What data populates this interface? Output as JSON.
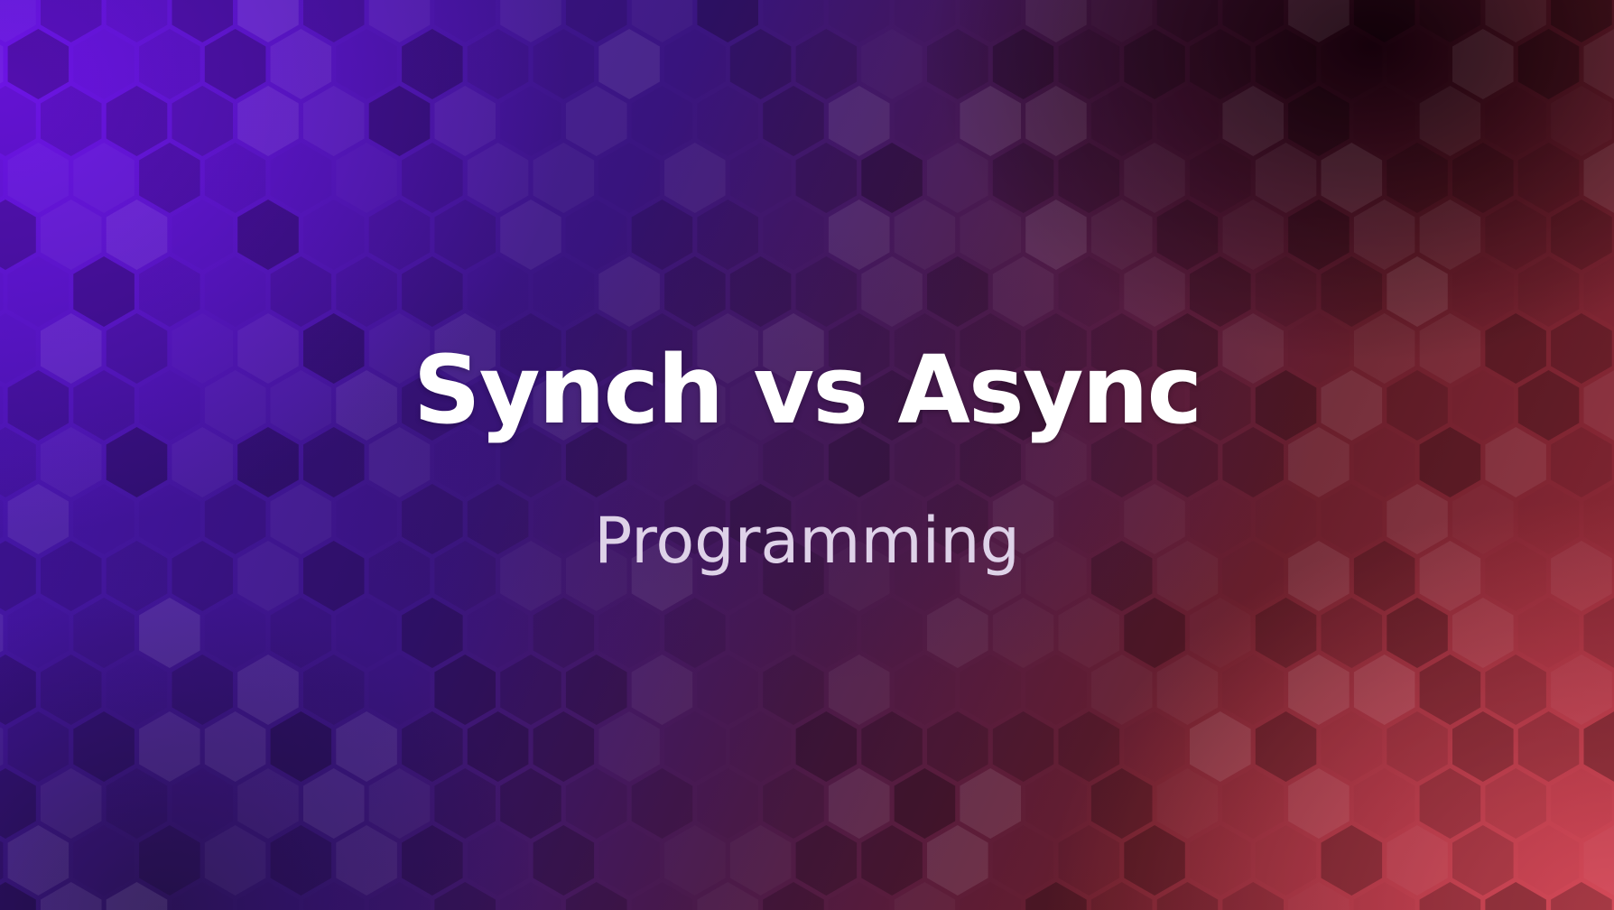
{
  "banner": {
    "title": "Synch vs Async",
    "subtitle": "Programming",
    "colors": {
      "left_accent": "#5a12c8",
      "right_accent": "#d8505c",
      "title_text": "#ffffff",
      "subtitle_text": "#ded2e8"
    },
    "background_pattern": "hexagon-grid"
  }
}
